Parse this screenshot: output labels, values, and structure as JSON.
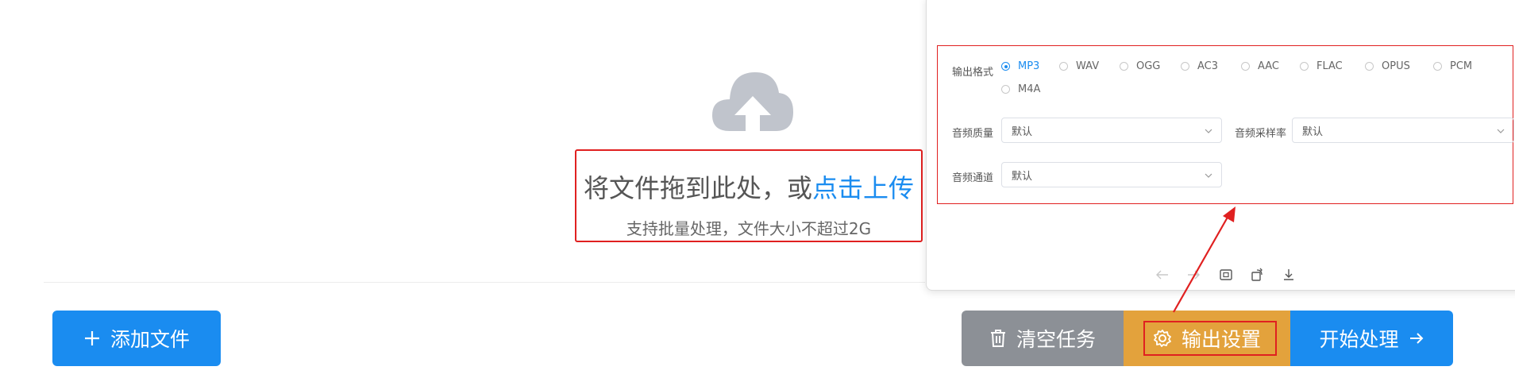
{
  "upload": {
    "title_prefix": "将文件拖到此处，或",
    "title_link": "点击上传",
    "subtitle": "支持批量处理，文件大小不超过2G"
  },
  "buttons": {
    "add_file": "添加文件",
    "clear_tasks": "清空任务",
    "output_settings": "输出设置",
    "start_processing": "开始处理"
  },
  "settings": {
    "format_label": "输出格式",
    "formats": [
      "MP3",
      "WAV",
      "OGG",
      "AC3",
      "AAC",
      "FLAC",
      "OPUS",
      "PCM",
      "M4A"
    ],
    "selected_format": "MP3",
    "quality_label": "音频质量",
    "quality_value": "默认",
    "samplerate_label": "音频采样率",
    "samplerate_value": "默认",
    "channel_label": "音频通道",
    "channel_value": "默认"
  },
  "colors": {
    "primary": "#1a8cf0",
    "gray_button": "#8c9096",
    "orange_button": "#e3a23c",
    "highlight": "#e02020"
  },
  "icons": {
    "upload": "cloud-upload-icon",
    "add": "plus-icon",
    "clear": "trash-icon",
    "settings": "gear-icon",
    "start": "arrow-right-icon"
  }
}
